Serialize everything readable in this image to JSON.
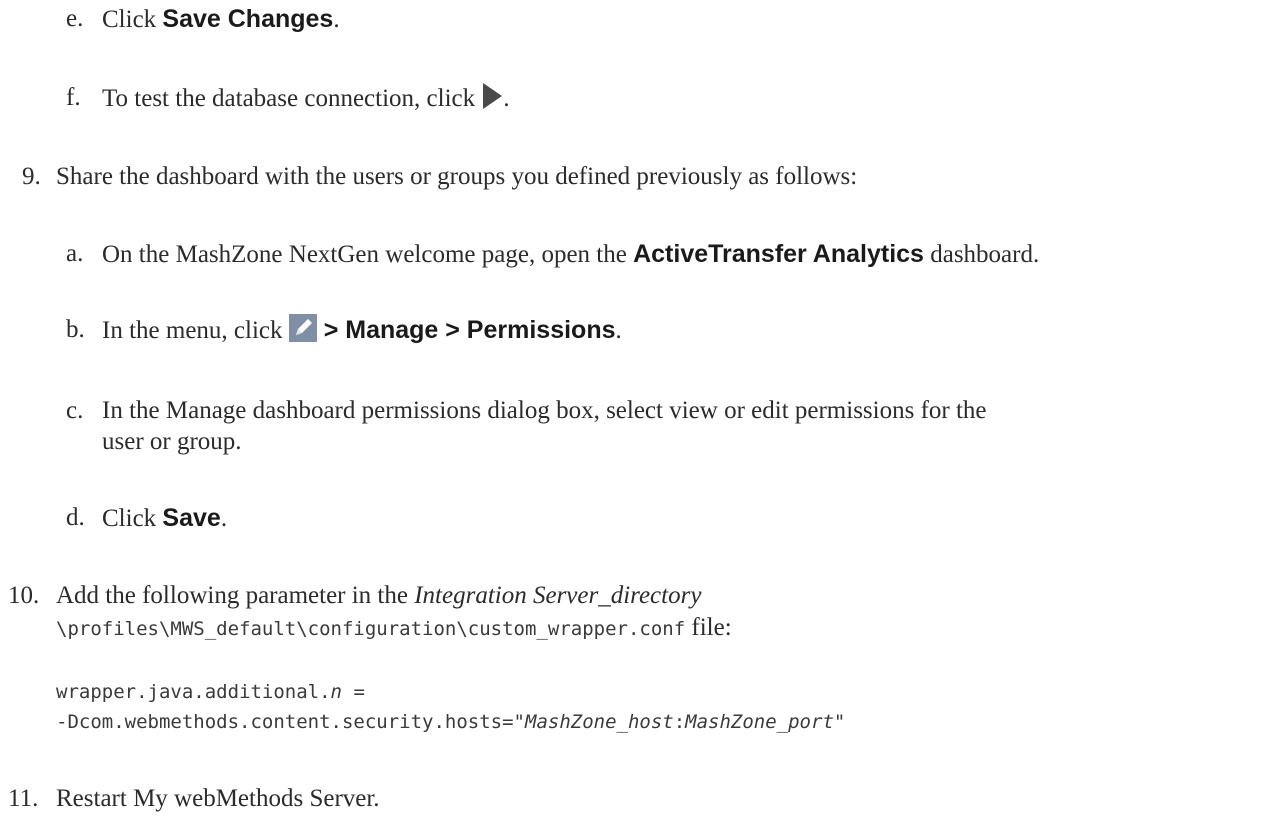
{
  "steps": {
    "e": {
      "marker": "e.",
      "pre": "Click ",
      "bold": "Save Changes",
      "post": "."
    },
    "f": {
      "marker": "f.",
      "text": "To test the database connection, click ",
      "icon": "play-icon",
      "post": "."
    },
    "s9": {
      "marker": "9.",
      "text": "Share the dashboard with the users or groups you defined previously as follows:"
    },
    "a": {
      "marker": "a.",
      "pre": "On the MashZone NextGen welcome page, open the ",
      "bold": "ActiveTransfer Analytics",
      "post": " dashboard."
    },
    "b": {
      "marker": "b.",
      "pre": "In the menu, click ",
      "icon": "pencil-icon",
      "bold": " > Manage > Permissions",
      "post": "."
    },
    "c": {
      "marker": "c.",
      "line1": "In the Manage dashboard permissions dialog box, select view or edit permissions for the",
      "line2": "user or group."
    },
    "d": {
      "marker": "d.",
      "pre": "Click ",
      "bold": "Save",
      "post": "."
    },
    "s10": {
      "marker": "10.",
      "pre": "Add the following parameter in the ",
      "italic": "Integration Server_directory",
      "path": "\\profiles\\MWS_default\\configuration\\custom_wrapper.conf",
      "post": " file:",
      "code1_pre": "wrapper.java.additional.",
      "code1_var": "n",
      "code1_post": " =",
      "code2_pre": "-Dcom.webmethods.content.security.hosts=\"",
      "code2_host": "MashZone_host",
      "code2_sep": ":",
      "code2_port": "MashZone_port",
      "code2_post": "\""
    },
    "s11": {
      "marker": "11.",
      "text": "Restart My webMethods Server."
    }
  },
  "colors": {
    "text": "#2b2b2b",
    "icon_play": "#4a4a4a",
    "icon_pencil_bg": "#7f8fa6"
  }
}
